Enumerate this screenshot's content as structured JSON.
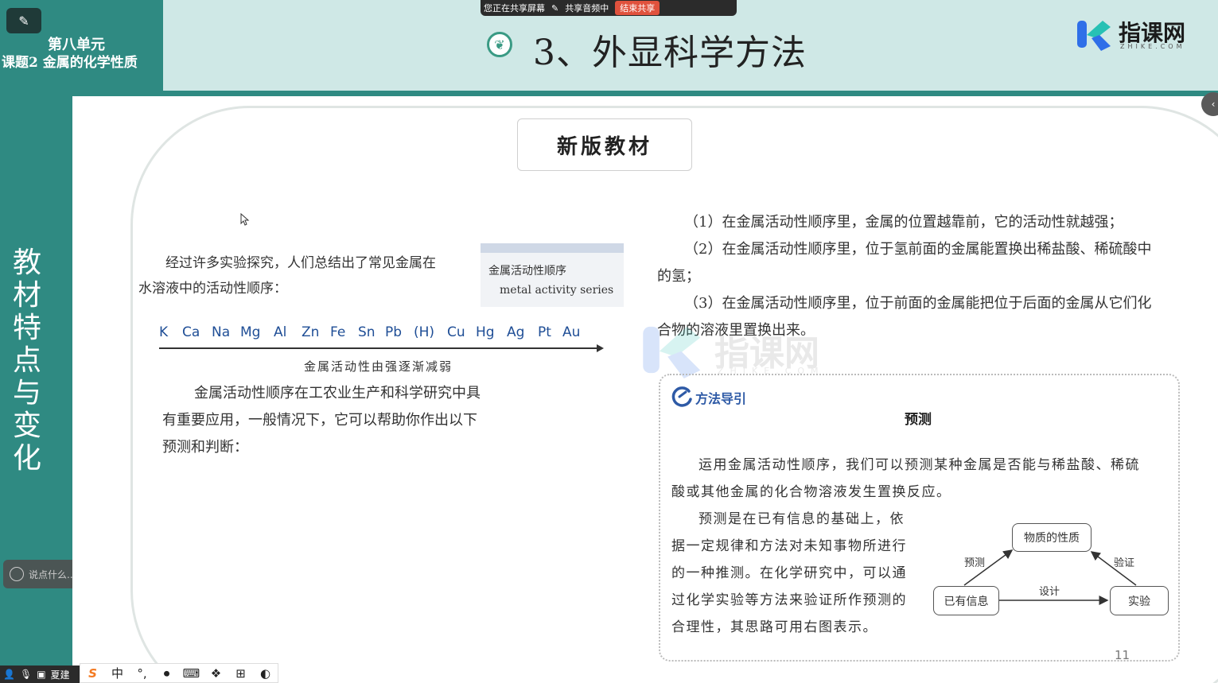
{
  "header": {
    "unit_line1": "第八单元",
    "unit_line2": "课题2  金属的化学性质",
    "title": "3、外显科学方法",
    "brand_name": "指课网",
    "brand_sub": "ZHIKE.COM"
  },
  "share_bar": {
    "sharing_screen": "您正在共享屏幕",
    "sharing_audio": "共享音频中",
    "stop_label": "结束共享"
  },
  "sidebar": {
    "vertical_text": "教材特点与变化",
    "chat_placeholder": "说点什么..."
  },
  "slide": {
    "badge": "新版教材",
    "left": {
      "intro_line1": "经过许多实验探究，人们总结出了常见金属在",
      "intro_line2": "水溶液中的活动性顺序：",
      "box_cn": "金属活动性顺序",
      "box_en": "metal activity series",
      "series": [
        "K",
        "Ca",
        "Na",
        "Mg",
        "Al",
        "Zn",
        "Fe",
        "Sn",
        "Pb",
        "(H)",
        "Cu",
        "Hg",
        "Ag",
        "Pt",
        "Au"
      ],
      "arrow_caption": "金属活动性由强逐渐减弱",
      "app_line1": "金属活动性顺序在工农业生产和科学研究中具",
      "app_line2": "有重要应用，一般情况下，它可以帮助你作出以下",
      "app_line3": "预测和判断："
    },
    "right": {
      "rule1": "（1）在金属活动性顺序里，金属的位置越靠前，它的活动性就越强；",
      "rule2a": "（2）在金属活动性顺序里，位于氢前面的金属能置换出稀盐酸、稀硫酸中",
      "rule2b": "的氢；",
      "rule3a": "（3）在金属活动性顺序里，位于前面的金属能把位于后面的金属从它们化",
      "rule3b": "合物的溶液里置换出来。"
    },
    "watermark": {
      "text": "指课网",
      "sub": "ZHIKE.COM"
    },
    "method": {
      "title": "方法导引",
      "subtitle": "预测",
      "line1": "运用金属活动性顺序，我们可以预测某种金属是否能与稀盐酸、稀硫",
      "line2": "酸或其他金属的化合物溶液发生置换反应。",
      "line3": "预测是在已有信息的基础上，依",
      "line4": "据一定规律和方法对未知事物所进行",
      "line5": "的一种推测。在化学研究中，可以通",
      "line6": "过化学实验等方法来验证所作预测的",
      "line7": "合理性，其思路可用右图表示。",
      "diagram": {
        "top": "物质的性质",
        "left": "已有信息",
        "right": "实验",
        "edge_predict": "预测",
        "edge_verify": "验证",
        "edge_design": "设计"
      }
    },
    "page_number": "11"
  },
  "taskbar": {
    "user": "夏建",
    "ime_mode": "中"
  },
  "colors": {
    "teal": "#2f8a82",
    "header_bg": "#cfe8e6",
    "series_blue": "#1f4e96",
    "method_blue": "#2e5aa6"
  }
}
